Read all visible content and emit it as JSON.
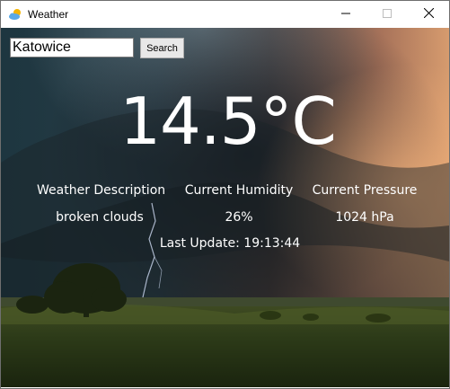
{
  "window": {
    "title": "Weather"
  },
  "search": {
    "value": "Katowice",
    "button_label": "Search"
  },
  "weather": {
    "temperature": "14.5°C",
    "description_label": "Weather Description",
    "description_value": "broken clouds",
    "humidity_label": "Current Humidity",
    "humidity_value": "26%",
    "pressure_label": "Current Pressure",
    "pressure_value": "1024 hPa",
    "last_update": "Last Update: 19:13:44"
  },
  "icons": {
    "app": "weather-app-icon",
    "minimize": "minimize-icon",
    "maximize": "maximize-icon",
    "close": "close-icon"
  }
}
